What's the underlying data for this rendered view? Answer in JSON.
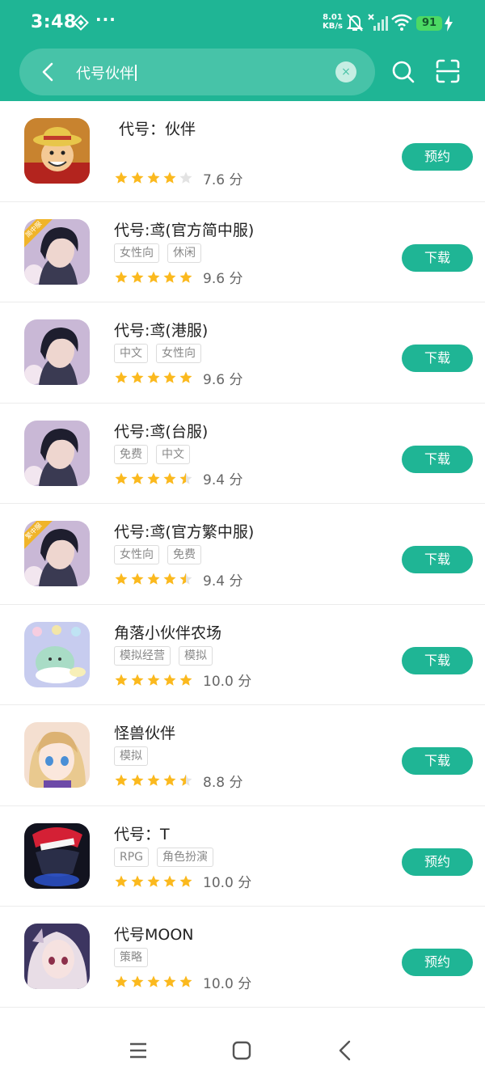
{
  "status_bar": {
    "time": "3:48",
    "dots": "···",
    "net_speed_value": "8.01",
    "net_speed_unit": "KB/s",
    "battery": "91"
  },
  "search": {
    "query": "代号伙伴",
    "clear_symbol": "×"
  },
  "colors": {
    "brand": "#1fb595",
    "star": "#fbb91e",
    "star_empty": "#e3e3e3"
  },
  "apps": [
    {
      "name": "代号：伙伴",
      "tags": [],
      "rating": 4,
      "score": "7.6 分",
      "action": "预约",
      "icon": "luffy-icon"
    },
    {
      "name": "代号:鸢(官方简中服)",
      "tags": [
        "女性向",
        "休闲"
      ],
      "rating": 5,
      "score": "9.6 分",
      "action": "下载",
      "icon": "yuan-icon",
      "badge": "简中服"
    },
    {
      "name": "代号:鸢(港服)",
      "tags": [
        "中文",
        "女性向"
      ],
      "rating": 5,
      "score": "9.6 分",
      "action": "下载",
      "icon": "yuan-icon"
    },
    {
      "name": "代号:鸢(台服)",
      "tags": [
        "免费",
        "中文"
      ],
      "rating": 4.5,
      "score": "9.4 分",
      "action": "下载",
      "icon": "yuan-icon"
    },
    {
      "name": "代号:鸢(官方繁中服)",
      "tags": [
        "女性向",
        "免费"
      ],
      "rating": 4.5,
      "score": "9.4 分",
      "action": "下载",
      "icon": "yuan-icon",
      "badge": "繁中服"
    },
    {
      "name": "角落小伙伴农场",
      "tags": [
        "模拟经营",
        "模拟"
      ],
      "rating": 5,
      "score": "10.0 分",
      "action": "下载",
      "icon": "sumikko-icon"
    },
    {
      "name": "怪兽伙伴",
      "tags": [
        "模拟"
      ],
      "rating": 4.5,
      "score": "8.8 分",
      "action": "下载",
      "icon": "anime-girl-icon"
    },
    {
      "name": "代号：T",
      "tags": [
        "RPG",
        "角色扮演"
      ],
      "rating": 5,
      "score": "10.0 分",
      "action": "预约",
      "icon": "robot-icon"
    },
    {
      "name": "代号MOON",
      "tags": [
        "策略"
      ],
      "rating": 5,
      "score": "10.0 分",
      "action": "预约",
      "icon": "moon-girl-icon"
    }
  ]
}
